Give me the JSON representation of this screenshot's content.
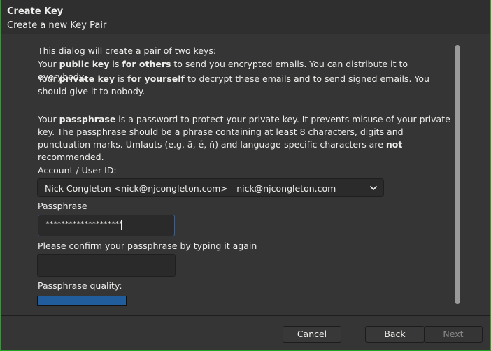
{
  "window": {
    "title": "Create Key",
    "subtitle": "Create a new Key Pair"
  },
  "intro": {
    "line1": "This dialog will create a pair of two keys:",
    "public_1": "Your ",
    "public_bold1": "public key",
    "public_2": " is ",
    "public_bold2": "for others",
    "public_3": " to send you encrypted emails. You can distribute it to everybody.",
    "private_1": "Your ",
    "private_bold1": "private key",
    "private_2": " is ",
    "private_bold2": "for yourself",
    "private_3": " to decrypt these emails and to send signed emails. You should give it to nobody.",
    "pass_1": "Your ",
    "pass_bold": "passphrase",
    "pass_2": " is a password to protect your private key. It prevents misuse of your private key. The passphrase should be a phrase containing at least 8 characters, digits and punctuation marks. Umlauts (e.g. ä, é, ñ) and language-specific characters are ",
    "pass_bold2": "not",
    "pass_3": " recommended."
  },
  "form": {
    "account_label": "Account / User ID:",
    "account_value": "Nick Congleton <nick@njcongleton.com> - nick@njcongleton.com",
    "passphrase_label": "Passphrase",
    "passphrase_value": "********************",
    "confirm_label": "Please confirm your passphrase by typing it again",
    "confirm_value": "",
    "quality_label": "Passphrase quality:",
    "quality_level": 1.0
  },
  "buttons": {
    "cancel": "Cancel",
    "back": "Back",
    "next": "Next"
  },
  "colors": {
    "accent_border": "#22a522",
    "focus": "#2f63a6",
    "quality": "#215d9c"
  }
}
